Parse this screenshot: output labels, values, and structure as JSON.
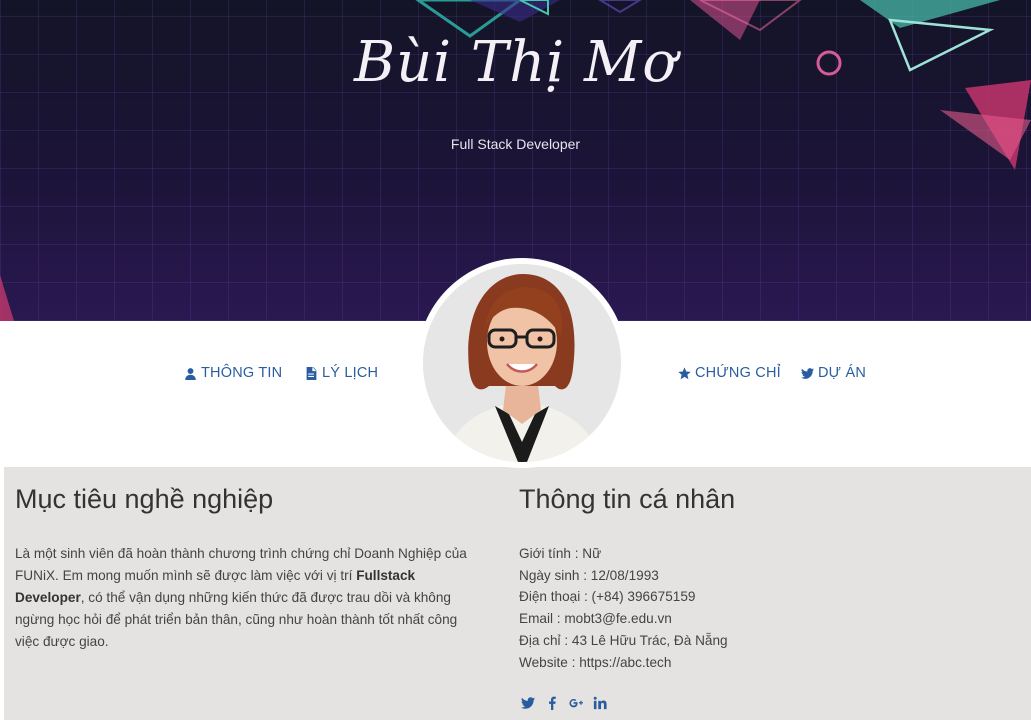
{
  "header": {
    "name": "Bùi Thị Mơ",
    "role": "Full Stack Developer"
  },
  "nav": {
    "info": "THÔNG TIN",
    "cv": "LÝ LỊCH",
    "certificates": "CHỨNG CHỈ",
    "projects": "DỰ ÁN"
  },
  "objective": {
    "title": "Mục tiêu nghề nghiệp",
    "text_1": "Là một sinh viên đã hoàn thành chương trình chứng chỉ Doanh Nghiệp của FUNiX. Em mong muốn mình sẽ được làm việc với vị trí ",
    "highlight": "Fullstack Developer",
    "text_2": ", có thể vận dụng những kiến thức đã được trau dồi và không ngừng học hỏi để phát triển bản thân, cũng như hoàn thành tốt nhất công việc được giao."
  },
  "personal": {
    "title": "Thông tin cá nhân",
    "gender": "Giới tính : Nữ",
    "birthday": "Ngày sinh : 12/08/1993",
    "phone": "Điện thoại : (+84) 396675159",
    "email": "Email : mobt3@fe.edu.vn",
    "address": "Địa chỉ : 43 Lê Hữu Trác, Đà Nẵng",
    "website": "Website : https://abc.tech"
  },
  "social": [
    "twitter-icon",
    "facebook-icon",
    "google-plus-icon",
    "linkedin-icon"
  ],
  "colors": {
    "accent": "#2a5d9f",
    "content_bg": "#e4e3e1",
    "hero_bg": "#1c1438"
  }
}
